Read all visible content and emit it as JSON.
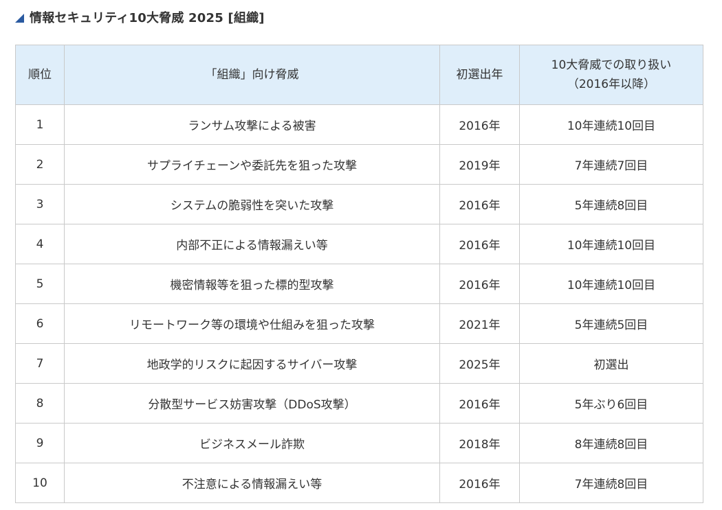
{
  "heading": {
    "icon": "triangle-corner-icon",
    "title": "情報セキュリティ10大脅威 2025 [組織]"
  },
  "colors": {
    "header_bg": "#dfeefa",
    "border": "#c9c9c9",
    "accent": "#2a5aa0",
    "text": "#333333"
  },
  "table": {
    "headers": {
      "rank": "順位",
      "threat": "「組織」向け脅威",
      "first_year": "初選出年",
      "handling_line1": "10大脅威での取り扱い",
      "handling_line2": "（2016年以降）"
    },
    "rows": [
      {
        "rank": "1",
        "threat": "ランサム攻撃による被害",
        "first_year": "2016年",
        "handling": "10年連続10回目"
      },
      {
        "rank": "2",
        "threat": "サプライチェーンや委託先を狙った攻撃",
        "first_year": "2019年",
        "handling": "7年連続7回目"
      },
      {
        "rank": "3",
        "threat": "システムの脆弱性を突いた攻撃",
        "first_year": "2016年",
        "handling": "5年連続8回目"
      },
      {
        "rank": "4",
        "threat": "内部不正による情報漏えい等",
        "first_year": "2016年",
        "handling": "10年連続10回目"
      },
      {
        "rank": "5",
        "threat": "機密情報等を狙った標的型攻撃",
        "first_year": "2016年",
        "handling": "10年連続10回目"
      },
      {
        "rank": "6",
        "threat": "リモートワーク等の環境や仕組みを狙った攻撃",
        "first_year": "2021年",
        "handling": "5年連続5回目"
      },
      {
        "rank": "7",
        "threat": "地政学的リスクに起因するサイバー攻撃",
        "first_year": "2025年",
        "handling": "初選出"
      },
      {
        "rank": "8",
        "threat": "分散型サービス妨害攻撃（DDoS攻撃）",
        "first_year": "2016年",
        "handling": "5年ぶり6回目"
      },
      {
        "rank": "9",
        "threat": "ビジネスメール詐欺",
        "first_year": "2018年",
        "handling": "8年連続8回目"
      },
      {
        "rank": "10",
        "threat": "不注意による情報漏えい等",
        "first_year": "2016年",
        "handling": "7年連続8回目"
      }
    ]
  }
}
